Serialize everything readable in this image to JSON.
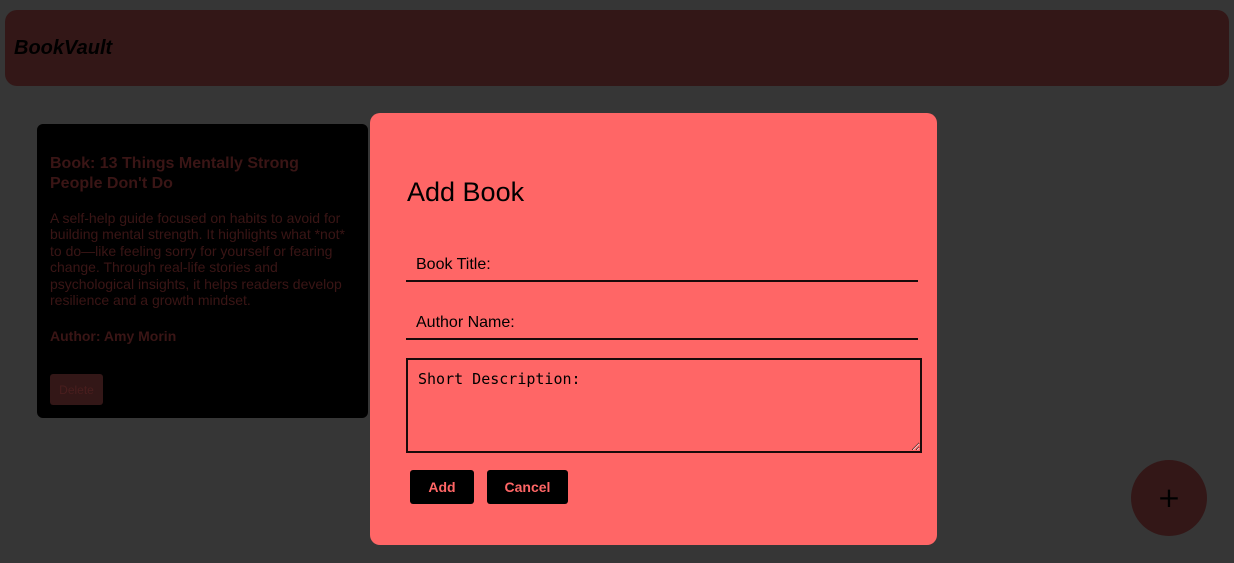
{
  "app": {
    "brand": "BookVault"
  },
  "books": [
    {
      "title": "Book: 13 Things Mentally Strong People Don't Do",
      "description": "A self-help guide focused on habits to avoid for building mental strength. It highlights what *not* to do—like feeling sorry for yourself or fearing change. Through real-life stories and psychological insights, it helps readers develop resilience and a growth mindset.",
      "author": "Author: Amy Morin",
      "delete_label": "Delete"
    }
  ],
  "modal": {
    "title": "Add Book",
    "book_title_placeholder": "Book Title:",
    "author_placeholder": "Author Name:",
    "description_placeholder": "Short Description:",
    "add_label": "Add",
    "cancel_label": "Cancel"
  },
  "fab": {
    "icon": "plus-icon",
    "symbol": "+"
  },
  "colors": {
    "background": "#363636",
    "navbar": "#331717",
    "card": "#000000",
    "modal": "#ff6666",
    "button": "#000000",
    "button_text": "#ff6666"
  }
}
